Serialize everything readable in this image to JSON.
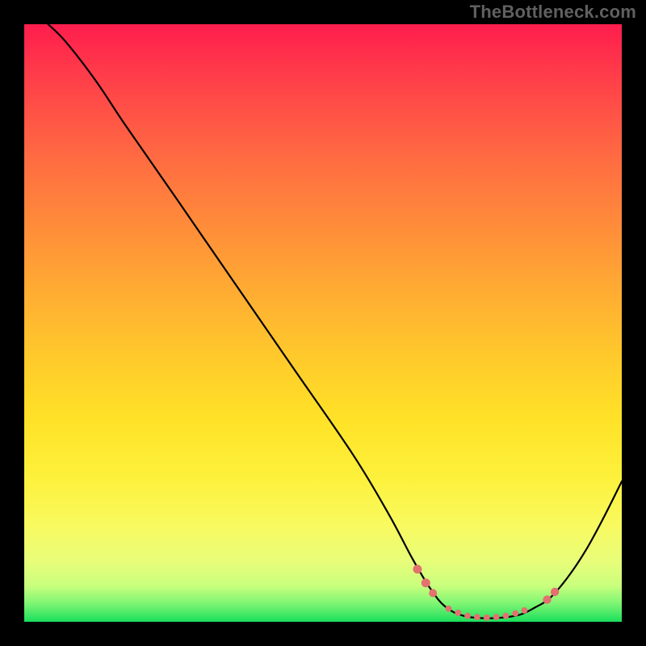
{
  "watermark": "TheBottleneck.com",
  "chart_data": {
    "type": "line",
    "title": "",
    "xlabel": "",
    "ylabel": "",
    "xlim": [
      0,
      100
    ],
    "ylim": [
      0,
      100
    ],
    "gradient_stops": [
      {
        "pos": 0,
        "color": "#ff1d4d"
      },
      {
        "pos": 10,
        "color": "#ff4249"
      },
      {
        "pos": 22,
        "color": "#ff6a42"
      },
      {
        "pos": 33,
        "color": "#ff8a3a"
      },
      {
        "pos": 44,
        "color": "#ffaa33"
      },
      {
        "pos": 55,
        "color": "#ffc82c"
      },
      {
        "pos": 66,
        "color": "#ffe227"
      },
      {
        "pos": 76,
        "color": "#fdf13c"
      },
      {
        "pos": 84,
        "color": "#f8fa60"
      },
      {
        "pos": 90,
        "color": "#e8fd7a"
      },
      {
        "pos": 94,
        "color": "#c8ff7d"
      },
      {
        "pos": 97,
        "color": "#7cf573"
      },
      {
        "pos": 100,
        "color": "#1adf5c"
      }
    ],
    "series": [
      {
        "name": "bottleneck-curve",
        "stroke": "#000000",
        "stroke_width": 2.2,
        "points": [
          {
            "x": 4.0,
            "y": 100.0
          },
          {
            "x": 7.0,
            "y": 97.0
          },
          {
            "x": 12.0,
            "y": 90.5
          },
          {
            "x": 17.0,
            "y": 83.0
          },
          {
            "x": 25.0,
            "y": 71.5
          },
          {
            "x": 35.0,
            "y": 57.0
          },
          {
            "x": 45.0,
            "y": 42.5
          },
          {
            "x": 55.0,
            "y": 28.0
          },
          {
            "x": 61.0,
            "y": 18.0
          },
          {
            "x": 65.0,
            "y": 10.5
          },
          {
            "x": 68.0,
            "y": 5.5
          },
          {
            "x": 70.5,
            "y": 2.5
          },
          {
            "x": 73.5,
            "y": 1.0
          },
          {
            "x": 77.0,
            "y": 0.6
          },
          {
            "x": 80.0,
            "y": 0.7
          },
          {
            "x": 83.0,
            "y": 1.2
          },
          {
            "x": 85.5,
            "y": 2.4
          },
          {
            "x": 88.0,
            "y": 4.0
          },
          {
            "x": 91.0,
            "y": 7.5
          },
          {
            "x": 94.0,
            "y": 12.0
          },
          {
            "x": 97.0,
            "y": 17.5
          },
          {
            "x": 100.0,
            "y": 23.5
          }
        ]
      }
    ],
    "markers": {
      "color": "#e4716f",
      "groups": [
        {
          "name": "valley-left-cluster",
          "points": [
            {
              "x": 65.8,
              "y": 8.8,
              "r": 5.5
            },
            {
              "x": 67.2,
              "y": 6.5,
              "r": 5.5
            },
            {
              "x": 68.4,
              "y": 4.8,
              "r": 5.0
            }
          ]
        },
        {
          "name": "valley-floor-cluster",
          "points": [
            {
              "x": 71.0,
              "y": 2.2,
              "r": 3.9
            },
            {
              "x": 72.6,
              "y": 1.5,
              "r": 3.9
            },
            {
              "x": 74.2,
              "y": 1.0,
              "r": 3.9
            },
            {
              "x": 75.8,
              "y": 0.8,
              "r": 3.9
            },
            {
              "x": 77.4,
              "y": 0.7,
              "r": 3.9
            },
            {
              "x": 79.0,
              "y": 0.8,
              "r": 3.9
            },
            {
              "x": 80.6,
              "y": 1.0,
              "r": 3.9
            },
            {
              "x": 82.2,
              "y": 1.4,
              "r": 3.9
            },
            {
              "x": 83.7,
              "y": 1.9,
              "r": 3.9
            }
          ]
        },
        {
          "name": "valley-right-cluster",
          "points": [
            {
              "x": 87.5,
              "y": 3.7,
              "r": 5.2
            },
            {
              "x": 88.8,
              "y": 5.0,
              "r": 5.2
            }
          ]
        }
      ]
    }
  }
}
